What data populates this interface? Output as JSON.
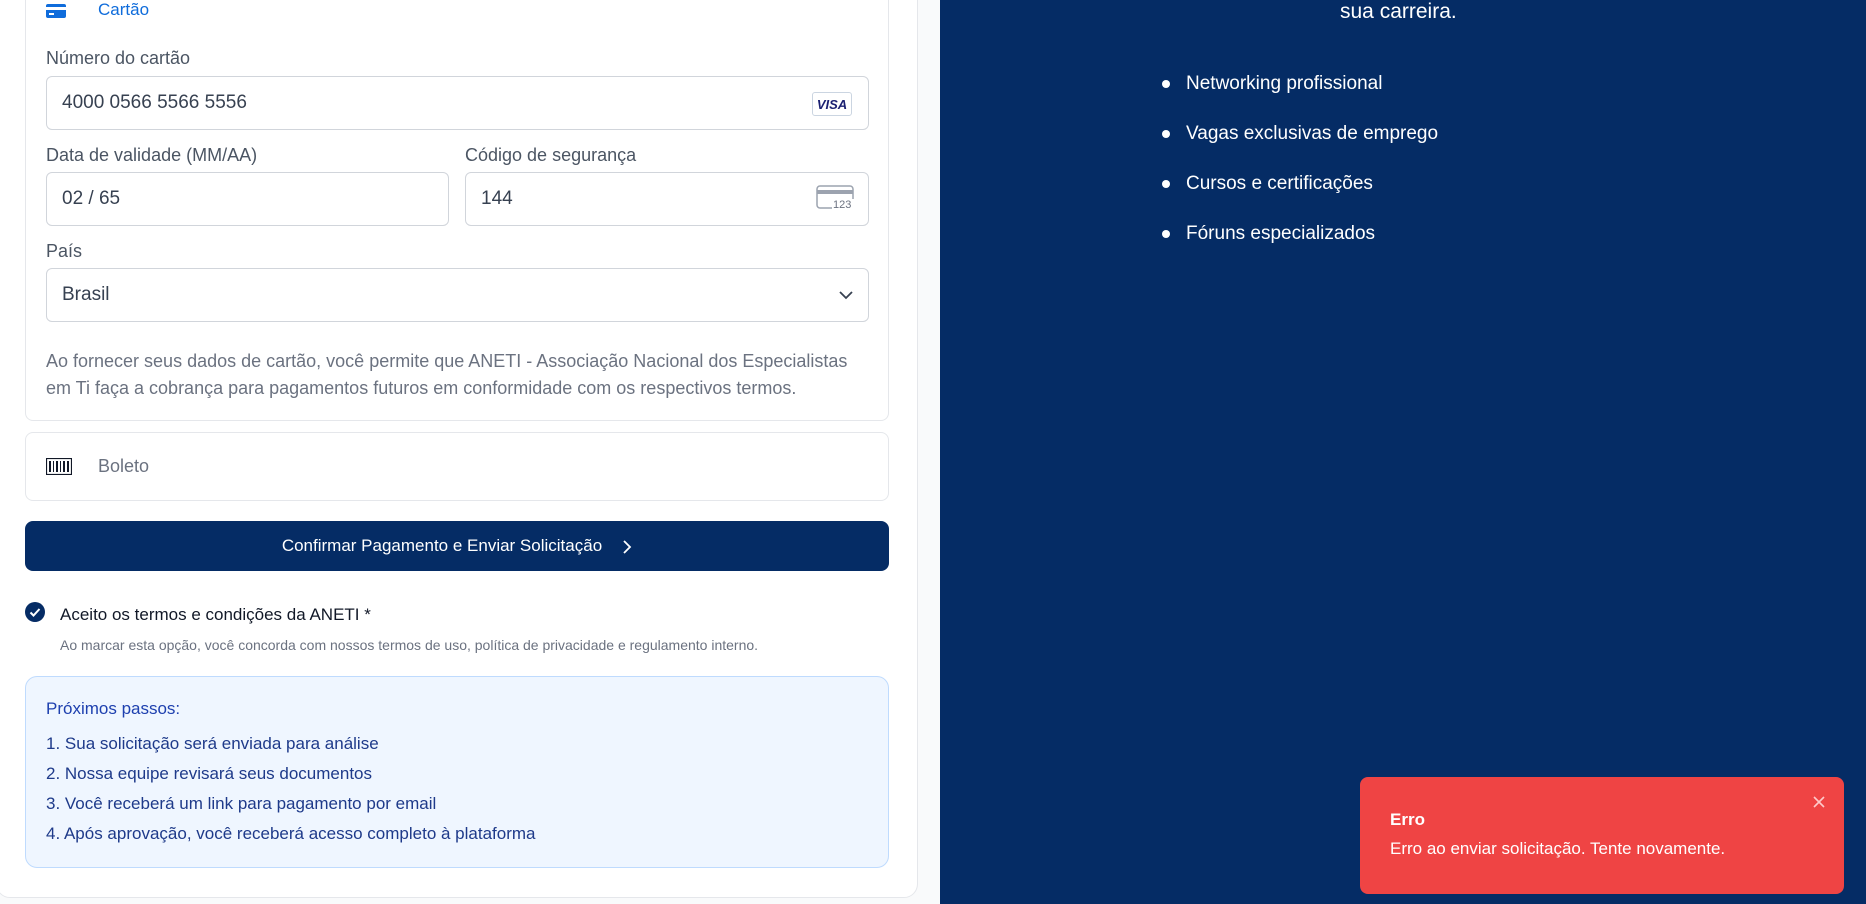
{
  "payment": {
    "card_tab_label": "Cartão",
    "card_number_label": "Número do cartão",
    "card_number_value": "4000 0566 5566 5556",
    "card_brand": "VISA",
    "expiry_label": "Data de validade (MM/AA)",
    "expiry_value": "02 / 65",
    "cvc_label": "Código de segurança",
    "cvc_value": "144",
    "cvc_icon_text": "123",
    "country_label": "País",
    "country_value": "Brasil",
    "disclaimer": "Ao fornecer seus dados de cartão, você permite que ANETI - Associação Nacional dos Especialistas em Ti faça a cobrança para pagamentos futuros em conformidade com os respectivos termos.",
    "boleto_label": "Boleto"
  },
  "confirm_button_label": "Confirmar Pagamento e Enviar Solicitação",
  "terms": {
    "checked": true,
    "label": "Aceito os termos e condições da ANETI *",
    "help": "Ao marcar esta opção, você concorda com nossos termos de uso, política de privacidade e regulamento interno."
  },
  "next_steps": {
    "title": "Próximos passos:",
    "items": [
      "1. Sua solicitação será enviada para análise",
      "2. Nossa equipe revisará seus documentos",
      "3. Você receberá um link para pagamento por email",
      "4. Após aprovação, você receberá acesso completo à plataforma"
    ]
  },
  "benefits": {
    "top_text": "sua carreira.",
    "items": [
      "Networking profissional",
      "Vagas exclusivas de emprego",
      "Cursos e certificações",
      "Fóruns especializados"
    ]
  },
  "toast": {
    "title": "Erro",
    "message": "Erro ao enviar solicitação. Tente novamente."
  },
  "colors": {
    "primary": "#052c65",
    "link": "#0f6cdb",
    "error": "#ef4444",
    "info_bg": "#eff6ff"
  }
}
